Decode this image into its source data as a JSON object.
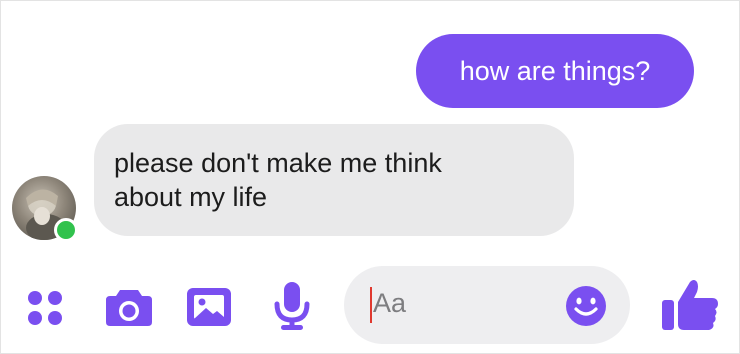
{
  "conversation": {
    "outgoing": [
      {
        "text": "how are things?"
      }
    ],
    "incoming": [
      {
        "line1": "please don't make me think",
        "line2": "about my life"
      }
    ],
    "contact": {
      "status": "online"
    }
  },
  "composer": {
    "placeholder": "Aa",
    "icons": [
      "menu-dots-icon",
      "camera-icon",
      "gallery-icon",
      "microphone-icon",
      "emoji-icon",
      "thumbs-up-icon"
    ]
  },
  "colors": {
    "accent": "#7a4ff0",
    "incoming_bubble": "#e9e9ea",
    "input_bg": "#eeeef0",
    "online": "#31c24d"
  }
}
